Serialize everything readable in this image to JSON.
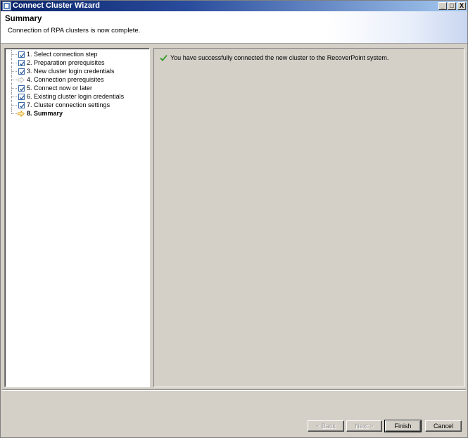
{
  "window": {
    "title": "Connect Cluster Wizard",
    "controls": [
      "_",
      "□",
      "X"
    ]
  },
  "header": {
    "title": "Summary",
    "subtitle": "Connection of RPA clusters is now complete."
  },
  "steps": [
    {
      "label": "1. Select connection step",
      "state": "done"
    },
    {
      "label": "2. Preparation prerequisites",
      "state": "done"
    },
    {
      "label": "3. New cluster login credentials",
      "state": "done"
    },
    {
      "label": "4. Connection prerequisites",
      "state": "skipped"
    },
    {
      "label": "5. Connect now or later",
      "state": "done"
    },
    {
      "label": "6. Existing cluster login credentials",
      "state": "done"
    },
    {
      "label": "7. Cluster connection settings",
      "state": "done"
    },
    {
      "label": "8. Summary",
      "state": "current"
    }
  ],
  "content": {
    "message": "You have successfully connected the new cluster to the RecoverPoint system.",
    "message_icon": "success-check-icon"
  },
  "buttons": {
    "back": "< Back",
    "next": "Next >",
    "finish": "Finish",
    "cancel": "Cancel"
  },
  "colors": {
    "title_bar": "#0a246a",
    "check": "#3b6ba8",
    "success": "#3aa02c",
    "current_arrow": "#e0a020"
  }
}
